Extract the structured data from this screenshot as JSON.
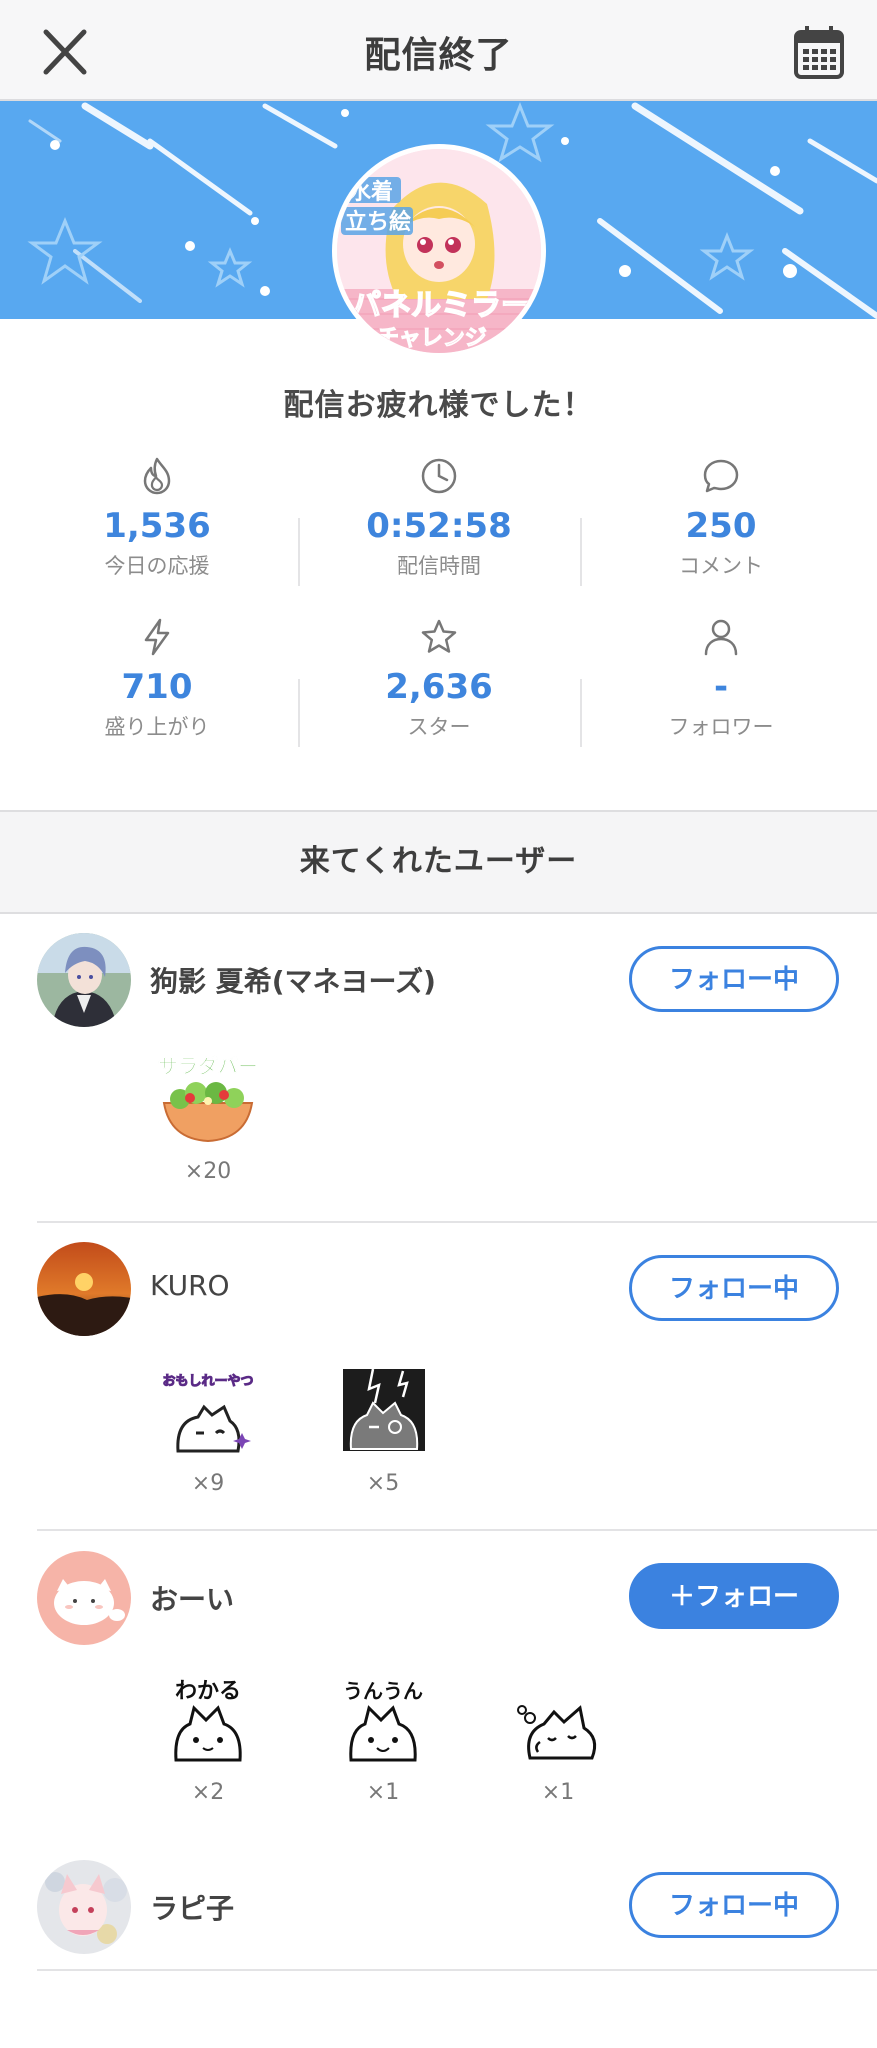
{
  "header": {
    "title": "配信終了",
    "close_icon": "close-icon",
    "calendar_icon": "calendar-icon"
  },
  "banner": {
    "bg_color": "#58a8f0",
    "avatar_texts": [
      "水着",
      "立ち絵",
      "パネルミラー",
      "チャレンジ"
    ]
  },
  "thanks": "配信お疲れ様でした！",
  "stats": [
    {
      "icon": "flame-icon",
      "value": "1,536",
      "label": "今日の応援"
    },
    {
      "icon": "clock-icon",
      "value": "0:52:58",
      "label": "配信時間"
    },
    {
      "icon": "comment-icon",
      "value": "250",
      "label": "コメント"
    },
    {
      "icon": "bolt-icon",
      "value": "710",
      "label": "盛り上がり"
    },
    {
      "icon": "star-icon",
      "value": "2,636",
      "label": "スター"
    },
    {
      "icon": "person-icon",
      "value": "-",
      "label": "フォロワー"
    }
  ],
  "visitors_title": "来てくれたユーザー",
  "users": [
    {
      "name": "狗影 夏希(マネヨーズ)",
      "follow_label": "フォロー中",
      "following": true,
      "gifts": [
        {
          "name": "サラダバー",
          "count": "×20"
        }
      ]
    },
    {
      "name": "KURO",
      "follow_label": "フォロー中",
      "following": true,
      "gifts": [
        {
          "name": "おもしれーやつ",
          "count": "×9"
        },
        {
          "name": "black-cat-sticker",
          "count": "×5"
        }
      ]
    },
    {
      "name": "おーい",
      "follow_label": "＋フォロー",
      "following": false,
      "gifts": [
        {
          "name": "わかる",
          "count": "×2"
        },
        {
          "name": "うんうん",
          "count": "×1"
        },
        {
          "name": "sleepy-cat-sticker",
          "count": "×1"
        }
      ]
    },
    {
      "name": "ラピ子",
      "follow_label": "フォロー中",
      "following": true,
      "gifts": []
    }
  ],
  "colors": {
    "accent": "#3b82e0",
    "value_blue": "#3e85dd",
    "banner": "#58a8f0"
  }
}
